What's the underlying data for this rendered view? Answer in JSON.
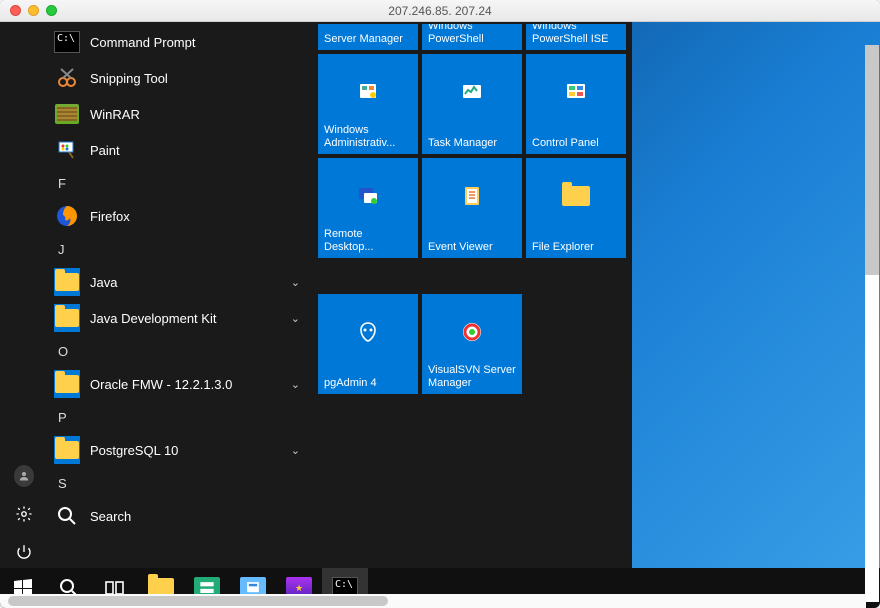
{
  "window": {
    "title": "207.246.85. 207.24"
  },
  "startMenu": {
    "apps": [
      {
        "label": "Command Prompt",
        "icon": "cmd"
      },
      {
        "label": "Snipping Tool",
        "icon": "snip"
      },
      {
        "label": "WinRAR",
        "icon": "winrar"
      },
      {
        "label": "Paint",
        "icon": "paint"
      }
    ],
    "sections": [
      {
        "letter": "F",
        "items": [
          {
            "label": "Firefox",
            "icon": "firefox"
          }
        ]
      },
      {
        "letter": "J",
        "items": [
          {
            "label": "Java",
            "icon": "folder",
            "expandable": true
          },
          {
            "label": "Java Development Kit",
            "icon": "folder",
            "expandable": true
          }
        ]
      },
      {
        "letter": "O",
        "items": [
          {
            "label": "Oracle FMW - 12.2.1.3.0",
            "icon": "folder",
            "expandable": true
          }
        ]
      },
      {
        "letter": "P",
        "items": [
          {
            "label": "PostgreSQL 10",
            "icon": "folder",
            "expandable": true
          }
        ]
      },
      {
        "letter": "S",
        "items": [
          {
            "label": "Search",
            "icon": "search"
          }
        ]
      }
    ],
    "tilesTopRow": [
      {
        "label": "Server Manager"
      },
      {
        "label": "Windows PowerShell"
      },
      {
        "label": "Windows PowerShell ISE"
      }
    ],
    "tiles": [
      {
        "label": "Windows Administrativ...",
        "icon": "admin"
      },
      {
        "label": "Task Manager",
        "icon": "taskmgr"
      },
      {
        "label": "Control Panel",
        "icon": "cpanel"
      },
      {
        "label": "Remote Desktop...",
        "icon": "rdp"
      },
      {
        "label": "Event Viewer",
        "icon": "event"
      },
      {
        "label": "File Explorer",
        "icon": "explorer"
      }
    ],
    "tilesGroup2": [
      {
        "label": "pgAdmin 4",
        "icon": "pgadmin"
      },
      {
        "label": "VisualSVN Server Manager",
        "icon": "visualsvn"
      }
    ]
  },
  "taskbar": {
    "items": [
      {
        "name": "start",
        "icon": "winlogo"
      },
      {
        "name": "search",
        "icon": "search"
      },
      {
        "name": "taskview",
        "icon": "taskview"
      },
      {
        "name": "file-explorer",
        "icon": "explorer"
      },
      {
        "name": "server-manager",
        "icon": "servermgr"
      },
      {
        "name": "server-manager-2",
        "icon": "servermgr2"
      },
      {
        "name": "app-purple",
        "icon": "purple"
      },
      {
        "name": "cmd",
        "icon": "cmd",
        "active": true
      }
    ]
  }
}
